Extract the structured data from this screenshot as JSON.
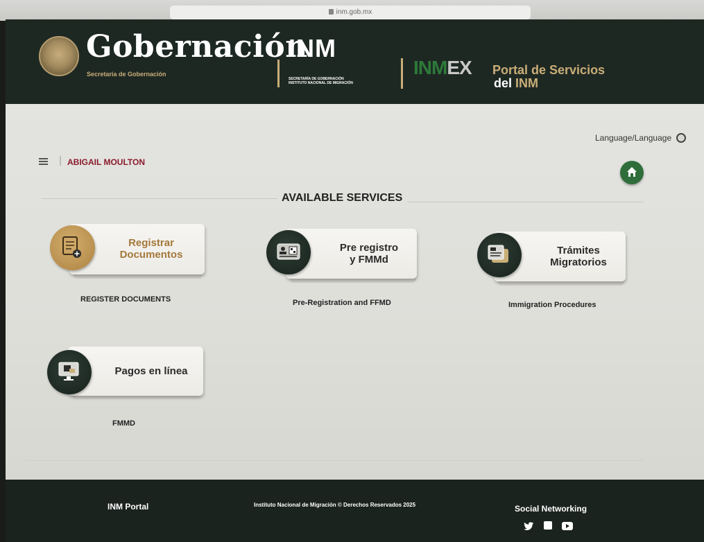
{
  "browser": {
    "url": "inm.gob.mx"
  },
  "header": {
    "gob_title": "Gobernación",
    "gob_subtitle": "Secretaría de Gobernación",
    "inm_logo": "INM",
    "inm_sub_line1": "SECRETARÍA DE GOBERNACIÓN",
    "inm_sub_line2": "INSTITUTO NACIONAL DE MIGRACIÓN",
    "inmex_logo_green": "INM",
    "inmex_logo_grey": "EX",
    "portal_line1": "Portal de Servicios",
    "portal_line2_prefix": "del ",
    "portal_line2_highlight": "INM"
  },
  "toolbar": {
    "language_label": "Language/Language",
    "user_name": "ABIGAIL MOULTON"
  },
  "main": {
    "section_title": "AVAILABLE SERVICES",
    "services": [
      {
        "line1": "Registrar",
        "line2": "Documentos",
        "caption": "REGISTER DOCUMENTS",
        "label_color": "#a4783a"
      },
      {
        "line1": "Pre registro",
        "line2": "y FMMd",
        "caption": "Pre-Registration and FFMD",
        "label_color": "#2b2b2b"
      },
      {
        "line1": "Trámites",
        "line2": "Migratorios",
        "caption": "Immigration Procedures",
        "label_color": "#2b2b2b"
      },
      {
        "line1": "Pagos en línea",
        "line2": "",
        "caption": "FMMD",
        "label_color": "#2b2b2b"
      }
    ]
  },
  "footer": {
    "portal_link": "INM Portal",
    "copyright": "Instituto Nacional de Migración © Derechos Reservados 2025",
    "social_title": "Social Networking"
  },
  "colors": {
    "header_bg": "#1e2823",
    "accent_gold": "#c9ae78",
    "user_red": "#8a1b2b",
    "home_green": "#2f6e3b",
    "footer_bg": "#1b231f"
  },
  "icons": [
    "lock-icon",
    "globe-icon",
    "menu-icon",
    "home-icon",
    "document-icon",
    "id-card-icon",
    "forms-icon",
    "monitor-payment-icon",
    "twitter-icon",
    "facebook-icon",
    "youtube-icon"
  ]
}
